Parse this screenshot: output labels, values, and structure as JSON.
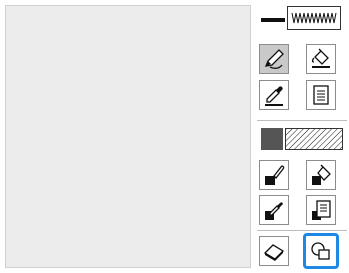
{
  "canvas": {
    "background": "#ececec"
  },
  "accent_color": "#1e88e5",
  "tools": {
    "line_style": {
      "solid_icon": "solid-line-icon",
      "pattern_icon": "zigzag-stitch-icon"
    },
    "pencil": "pencil-icon",
    "fill_bucket": "paint-bucket-icon",
    "line_eyedropper": "eyedropper-icon",
    "line_settings": "document-lines-icon",
    "fill_swatch": {
      "solid_color": "#555555",
      "pattern_icon": "hatch-pattern-icon"
    },
    "brush": "paint-brush-icon",
    "fill_bucket_alt": "paint-bucket-fill-icon",
    "fill_eyedropper": "eyedropper-icon",
    "fill_settings": "document-lines-icon",
    "eraser": "eraser-icon",
    "shapes": "shapes-icon"
  }
}
